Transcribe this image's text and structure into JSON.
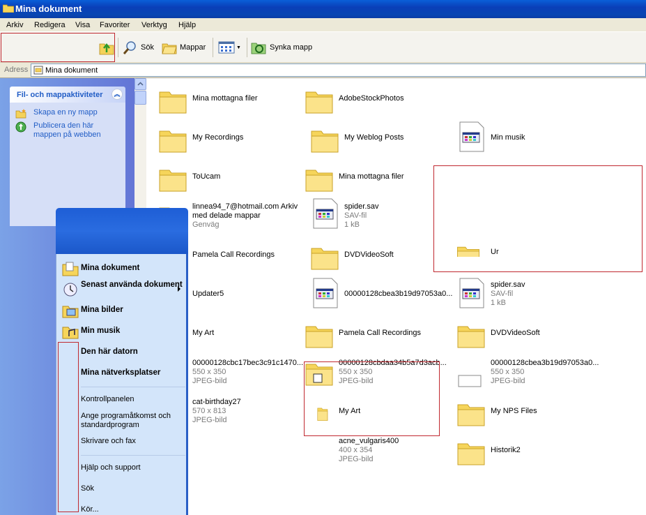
{
  "window": {
    "title": "Mina dokument"
  },
  "menu": [
    "Arkiv",
    "Redigera",
    "Visa",
    "Favoriter",
    "Verktyg",
    "Hjälp"
  ],
  "toolbar": {
    "search": "Sök",
    "folders": "Mappar",
    "sync": "Synka mapp"
  },
  "address": {
    "label": "Adress",
    "value": "Mina dokument"
  },
  "tasks": {
    "title": "Fil- och mappaktiviteter",
    "items": [
      "Skapa en ny mapp",
      "Publicera den här mappen på webben"
    ]
  },
  "files": [
    {
      "name": "Mina mottagna filer",
      "type": "folder"
    },
    {
      "name": "AdobeStockPhotos",
      "type": "folder"
    },
    {
      "name": "My Recordings",
      "type": "folder"
    },
    {
      "name": "My Weblog Posts",
      "type": "folder"
    },
    {
      "name": "Min musik",
      "type": "doc"
    },
    {
      "name": "ToUcam",
      "type": "folder"
    },
    {
      "name": "Mina mottagna filer",
      "type": "folder"
    },
    {
      "name": "linnea94_7@hotmail.com Arkiv med delade mappar",
      "sub1": "Genväg",
      "type": "folder"
    },
    {
      "name": "spider.sav",
      "sub1": "SAV-fil",
      "sub2": "1 kB",
      "type": "doc"
    },
    {
      "name": "Pamela Call Recordings",
      "type": "folder"
    },
    {
      "name": "DVDVideoSoft",
      "type": "folder"
    },
    {
      "name": "Updater5",
      "type": "folder"
    },
    {
      "name": "00000128cbea3b19d97053a0...",
      "type": "doc"
    },
    {
      "name": "spider.sav",
      "sub1": "SAV-fil",
      "sub2": "1 kB",
      "type": "doc"
    },
    {
      "name": "My Art",
      "type": "folder"
    },
    {
      "name": "Pamela Call Recordings",
      "type": "folder"
    },
    {
      "name": "DVDVideoSoft",
      "type": "folder"
    },
    {
      "name": "00000128cbc17bec3c91c1470...",
      "sub1": "550 x 350",
      "sub2": "JPEG-bild",
      "type": "image"
    },
    {
      "name": "00000128cbdaa34b5a7d3acb...",
      "sub1": "550 x 350",
      "sub2": "JPEG-bild",
      "type": "folder"
    },
    {
      "name": "00000128cbea3b19d97053a0...",
      "sub1": "550 x 350",
      "sub2": "JPEG-bild",
      "type": "image"
    },
    {
      "name": "cat-birthday27",
      "sub1": "570 x 813",
      "sub2": "JPEG-bild",
      "type": "image"
    },
    {
      "name": "My Art",
      "type": "folder"
    },
    {
      "name": "My NPS Files",
      "type": "folder"
    },
    {
      "name": "acne_vulgaris400",
      "sub1": "400 x 354",
      "sub2": "JPEG-bild",
      "type": "image"
    },
    {
      "name": "Historik2",
      "type": "folder"
    },
    {
      "name": "Ur",
      "type": "folder"
    }
  ],
  "start_menu": {
    "items": [
      "Mina dokument",
      "Senast använda dokument",
      "Mina bilder",
      "Min musik",
      "Den här datorn",
      "Mina nätverksplatser",
      "Kontrollpanelen",
      "Ange programåtkomst och standardprogram",
      "Skrivare och fax",
      "Hjälp och support",
      "Sök",
      "Kör..."
    ]
  },
  "colors": {
    "titlebar": "#0a3fb8",
    "highlight_box": "#c0282f",
    "task_link": "#215dc6"
  }
}
